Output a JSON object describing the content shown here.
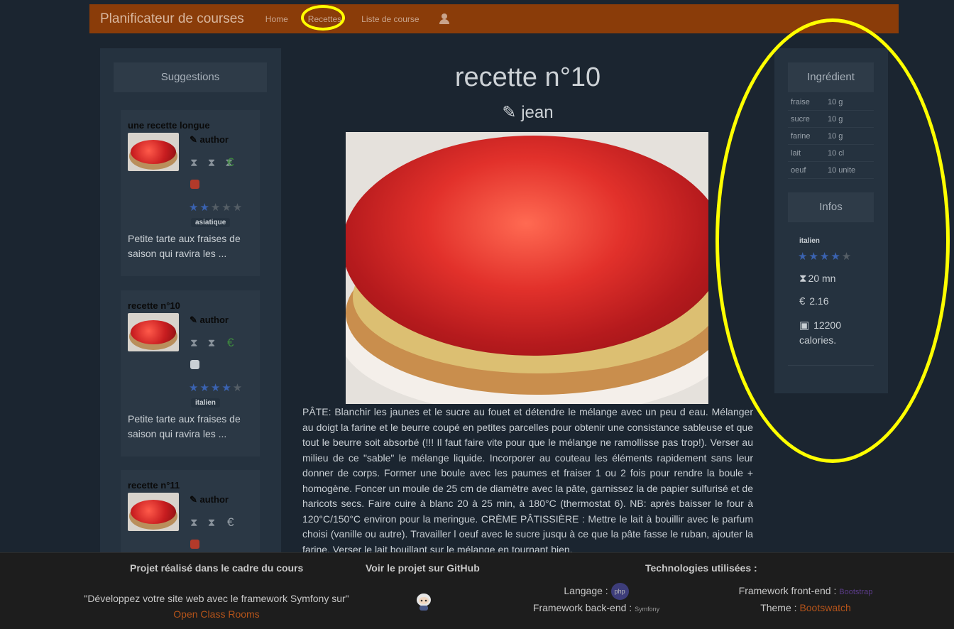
{
  "navbar": {
    "brand": "Planificateur de courses",
    "links": [
      "Home",
      "Recettes",
      "Liste de course"
    ],
    "user_icon": "user-icon"
  },
  "sidebar": {
    "title": "Suggestions",
    "cards": [
      {
        "title": "une recette longue",
        "author": "author",
        "hourglasses": "⧗ ⧗ ⧗",
        "cost": "€",
        "cost_color": "#3e8c3e",
        "stars": 2,
        "category": "asiatique",
        "description": "Petite tarte aux fraises de saison qui ravira les ..."
      },
      {
        "title": "recette n°10",
        "author": "author",
        "hourglasses": "⧗ ⧗",
        "cost": "€",
        "cost_color": "#3e8c3e",
        "stars": 4,
        "category": "italien",
        "description": "Petite tarte aux fraises de saison qui ravira les ..."
      },
      {
        "title": "recette n°11",
        "author": "author",
        "hourglasses": "⧗ ⧗",
        "cost": "€",
        "cost_color": "#9aa3ab",
        "stars": 0,
        "category": "",
        "description": ""
      }
    ]
  },
  "recipe": {
    "title": "recette n°10",
    "author": "jean",
    "text": "PÂTE: Blanchir les jaunes et le sucre au fouet et détendre le mélange avec un peu d eau. Mélanger au doigt la farine et le beurre coupé en petites parcelles pour obtenir une consistance sableuse et que tout le beurre soit absorbé (!!! Il faut faire vite pour que le mélange ne ramollisse pas trop!). Verser au milieu de ce \"sable\" le mélange liquide. Incorporer au couteau les éléments rapidement sans leur donner de corps. Former une boule avec les paumes et fraiser 1 ou 2 fois pour rendre la boule + homogène. Foncer un moule de 25 cm de diamètre avec la pâte, garnissez la de papier sulfurisé et de haricots secs. Faire cuire à blanc 20 à 25 min, à 180°C (thermostat 6). NB: après baisser le four à 120°C/150°C environ pour la meringue. CRÈME PÂTISSIÈRE : Mettre le lait à bouillir avec le parfum choisi (vanille ou autre). Travailler l oeuf avec le sucre jusqu à ce que la pâte fasse le ruban, ajouter la farine. Verser le lait bouillant sur le mélange en tournant bien."
  },
  "ingredients": {
    "title": "Ingrédient",
    "rows": [
      {
        "name": "fraise",
        "qty": "10 g"
      },
      {
        "name": "sucre",
        "qty": "10 g"
      },
      {
        "name": "farine",
        "qty": "10 g"
      },
      {
        "name": "lait",
        "qty": "10 cl"
      },
      {
        "name": "oeuf",
        "qty": "10 unite"
      }
    ]
  },
  "infos": {
    "title": "Infos",
    "category": "italien",
    "stars": 4,
    "time": "20 mn",
    "price": "2.16",
    "calories": "12200 calories."
  },
  "footer": {
    "col1_title": "Projet réalisé dans le cadre du cours",
    "col1_text": "\"Développez votre site web avec le framework Symfony sur\"",
    "col1_link": "Open Class Rooms",
    "col2_title": "Voir le projet sur GitHub",
    "col3_title": "Technologies utilisées :",
    "lang_label": "Langage :",
    "lang_logo": "php",
    "backend_label": "Framework back-end :",
    "backend_logo": "Symfony",
    "frontend_label": "Framework front-end :",
    "frontend_logo": "Bootstrap",
    "theme_label": "Theme :",
    "theme_link": "Bootswatch"
  },
  "annotations": {
    "highlight_color": "#ffff00"
  }
}
